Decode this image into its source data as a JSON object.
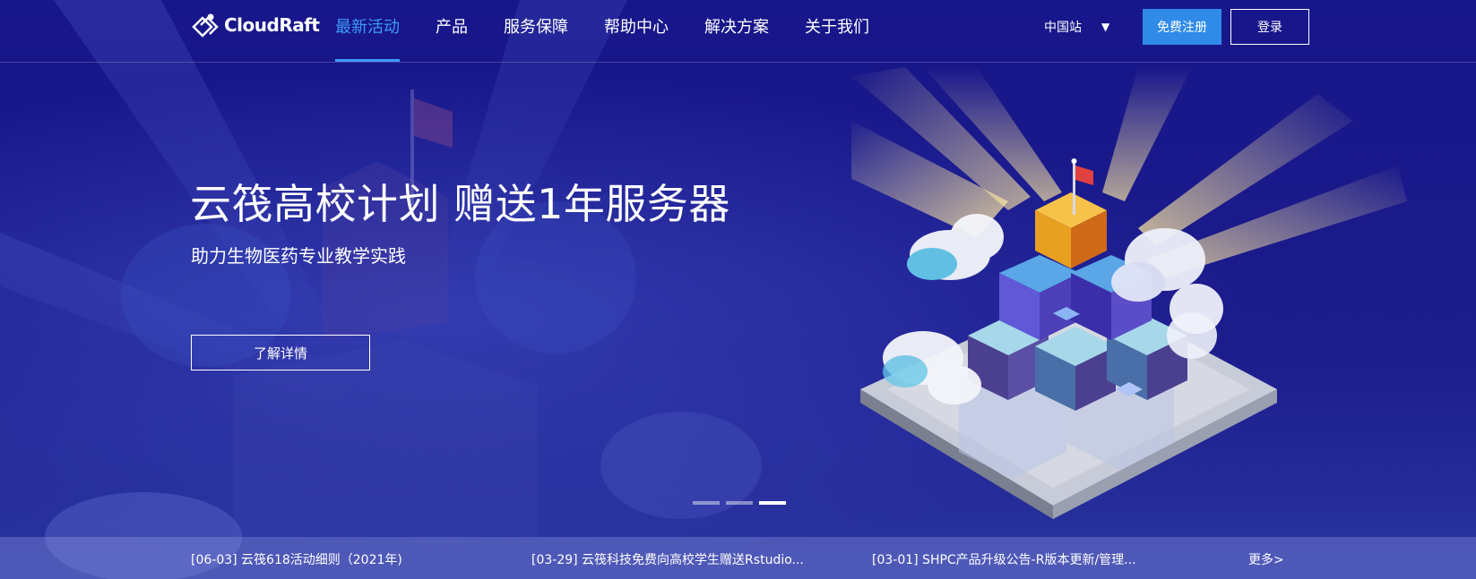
{
  "header": {
    "brand": "CloudRaft",
    "nav": [
      "最新活动",
      "产品",
      "服务保障",
      "帮助中心",
      "解决方案",
      "关于我们"
    ],
    "active_nav": "最新活动",
    "region": "中国站",
    "register": "免费注册",
    "login": "登录"
  },
  "hero": {
    "title": "云筏高校计划 赠送1年服务器",
    "subtitle": "助力生物医药专业教学实践",
    "cta": "了解详情"
  },
  "carousel": {
    "slides": 3,
    "active": 3
  },
  "news": {
    "items": [
      "[06-03] 云筏618活动细则（2021年)",
      "[03-29] 云筏科技免费向高校学生赠送Rstudio...",
      "[03-01] SHPC产品升级公告-R版本更新/管理..."
    ],
    "more": "更多>"
  },
  "colors": {
    "background": "#1a1980",
    "accent": "#3c9af7",
    "register_btn": "#2f8ae8"
  }
}
